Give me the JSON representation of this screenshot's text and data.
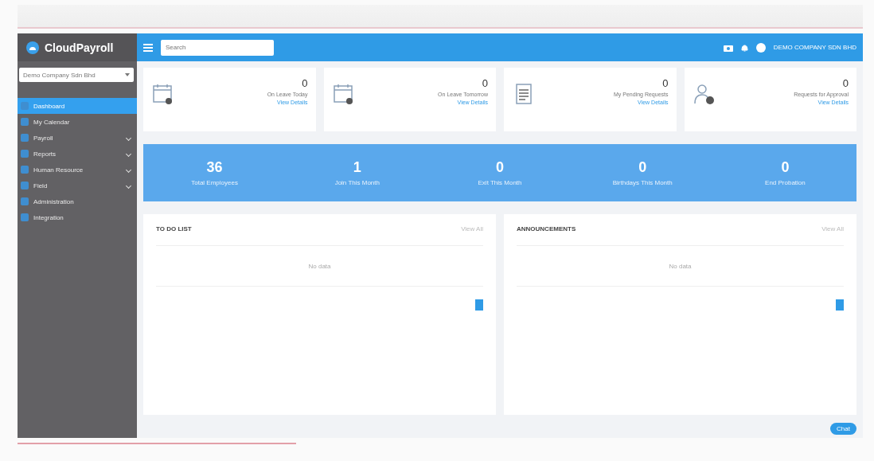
{
  "brand": {
    "name": "CloudPayroll"
  },
  "company_select": {
    "value": "Demo Company Sdn Bhd"
  },
  "sidebar": {
    "items": [
      {
        "label": "Dashboard",
        "selected": true,
        "has_children": false
      },
      {
        "label": "My Calendar",
        "selected": false,
        "has_children": false
      },
      {
        "label": "Payroll",
        "selected": false,
        "has_children": true
      },
      {
        "label": "Reports",
        "selected": false,
        "has_children": true
      },
      {
        "label": "Human Resource",
        "selected": false,
        "has_children": true
      },
      {
        "label": "Field",
        "selected": false,
        "has_children": true
      },
      {
        "label": "Administration",
        "selected": false,
        "has_children": false
      },
      {
        "label": "Integration",
        "selected": false,
        "has_children": false
      }
    ]
  },
  "topbar": {
    "search_placeholder": "Search",
    "user": "DEMO COMPANY SDN BHD"
  },
  "summary_cards": [
    {
      "kind": "calendar",
      "count": "0",
      "label": "On Leave Today",
      "link": "View Details"
    },
    {
      "kind": "calendar",
      "count": "0",
      "label": "On Leave Tomorrow",
      "link": "View Details"
    },
    {
      "kind": "document",
      "count": "0",
      "label": "My Pending Requests",
      "link": "View Details"
    },
    {
      "kind": "person",
      "count": "0",
      "label": "Requests for Approval",
      "link": "View Details"
    }
  ],
  "stats": [
    {
      "value": "36",
      "label": "Total Employees"
    },
    {
      "value": "1",
      "label": "Join This Month"
    },
    {
      "value": "0",
      "label": "Exit This Month"
    },
    {
      "value": "0",
      "label": "Birthdays This Month"
    },
    {
      "value": "0",
      "label": "End Probation"
    }
  ],
  "panels": [
    {
      "title": "TO DO LIST",
      "action": "View All",
      "empty": "No data"
    },
    {
      "title": "ANNOUNCEMENTS",
      "action": "View All",
      "empty": "No data"
    }
  ],
  "chat_button": {
    "label": "Chat"
  }
}
